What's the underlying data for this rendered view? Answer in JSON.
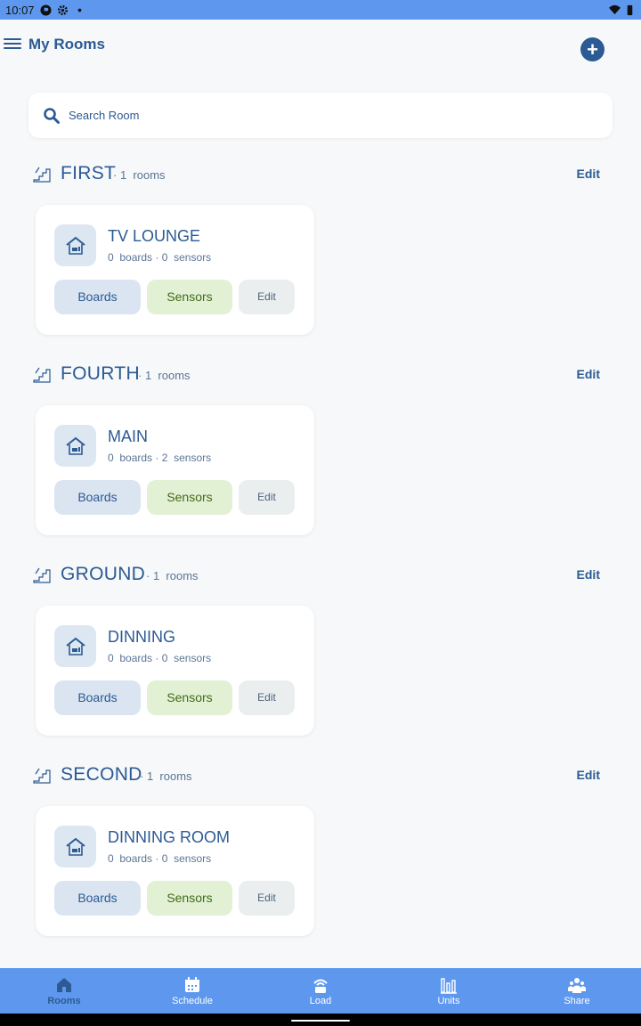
{
  "status_bar": {
    "time": "10:07"
  },
  "header": {
    "title": "My Rooms"
  },
  "search": {
    "placeholder": "Search Room"
  },
  "floor_common": {
    "rooms_suffix": "rooms",
    "edit_label": "Edit",
    "boards_suffix": "boards",
    "sensors_suffix": "sensors"
  },
  "buttons": {
    "boards": "Boards",
    "sensors": "Sensors",
    "edit": "Edit"
  },
  "floors": [
    {
      "name": "FIRST",
      "count": "1",
      "rooms": [
        {
          "name": "TV LOUNGE",
          "boards": "0",
          "sensors": "0"
        }
      ]
    },
    {
      "name": "FOURTH",
      "count": "1",
      "rooms": [
        {
          "name": "MAIN",
          "boards": "0",
          "sensors": "2"
        }
      ]
    },
    {
      "name": "GROUND",
      "count": "1",
      "rooms": [
        {
          "name": "DINNING",
          "boards": "0",
          "sensors": "0"
        }
      ]
    },
    {
      "name": "SECOND",
      "count": "1",
      "rooms": [
        {
          "name": "DINNING ROOM",
          "boards": "0",
          "sensors": "0"
        }
      ]
    }
  ],
  "bottom_nav": [
    {
      "label": "Rooms",
      "icon": "home-icon",
      "active": true
    },
    {
      "label": "Schedule",
      "icon": "calendar-icon",
      "active": false
    },
    {
      "label": "Load",
      "icon": "load-icon",
      "active": false
    },
    {
      "label": "Units",
      "icon": "bar-chart-icon",
      "active": false
    },
    {
      "label": "Share",
      "icon": "people-icon",
      "active": false
    }
  ],
  "colors": {
    "primary": "#2c5a93",
    "accent": "#5e98ee",
    "sensors_bg": "#e2f0d4",
    "boards_bg": "#dae5f1",
    "background": "#f6f8fa"
  }
}
